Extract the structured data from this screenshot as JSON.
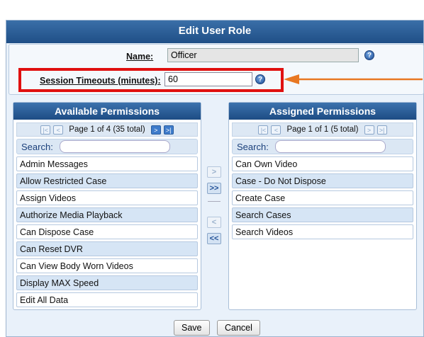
{
  "dialog": {
    "title": "Edit User Role"
  },
  "fields": {
    "name_label": "Name:",
    "name_value": "Officer",
    "session_label": "Session Timeouts (minutes):",
    "session_value": "60",
    "help_glyph": "?"
  },
  "available": {
    "title": "Available Permissions",
    "pager": "Page 1 of 4 (35 total)",
    "search_label": "Search:",
    "items": [
      "Admin Messages",
      "Allow Restricted Case",
      "Assign Videos",
      "Authorize Media Playback",
      "Can Dispose Case",
      "Can Reset DVR",
      "Can View Body Worn Videos",
      "Display MAX Speed",
      "Edit All Data"
    ]
  },
  "assigned": {
    "title": "Assigned Permissions",
    "pager": "Page 1 of 1 (5 total)",
    "search_label": "Search:",
    "items": [
      "Can Own Video",
      "Case - Do Not Dispose",
      "Create Case",
      "Search Cases",
      "Search Videos"
    ]
  },
  "transfer": {
    "add_one": ">",
    "add_all": ">>",
    "remove_one": "<",
    "remove_all": "<<"
  },
  "pager_glyphs": {
    "first": "|<",
    "prev": "<",
    "next": ">",
    "last": ">|"
  },
  "footer": {
    "save_label": "Save",
    "cancel_label": "Cancel"
  },
  "colors": {
    "header": "#1f4f86",
    "highlight": "#e01010",
    "annotation_arrow": "#e87722"
  },
  "icons": [
    "help-icon",
    "first-page-icon",
    "prev-page-icon",
    "next-page-icon",
    "last-page-icon",
    "annotation-arrow-icon"
  ]
}
